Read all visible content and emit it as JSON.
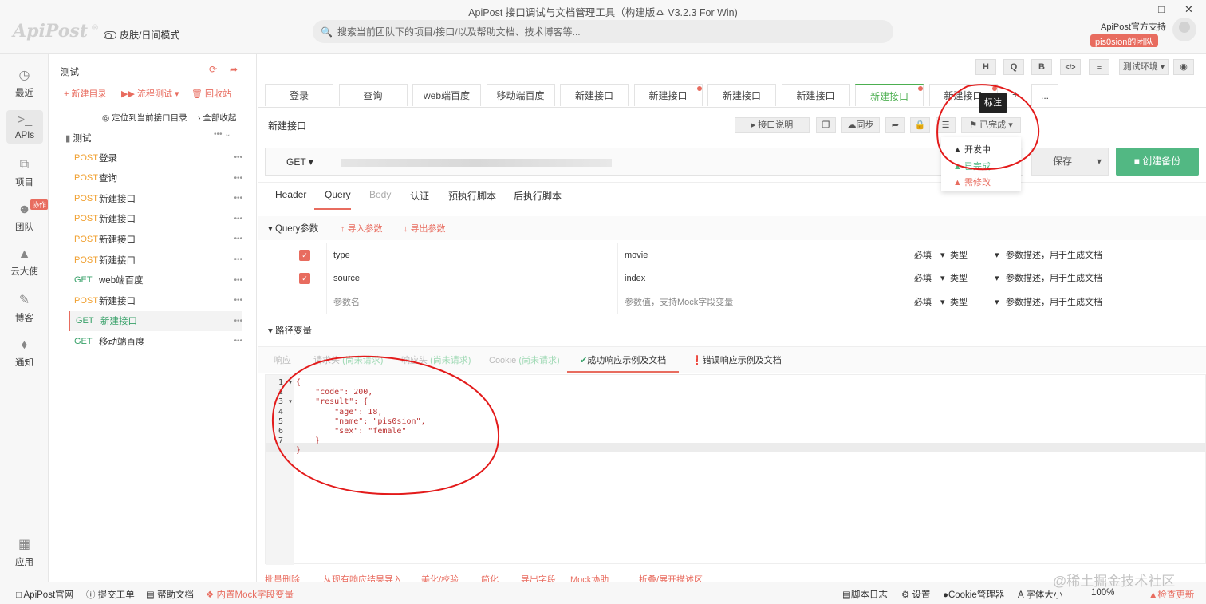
{
  "window": {
    "title": "ApiPost 接口调试与文档管理工具（构建版本 V3.2.3 For Win)",
    "logo": "ApiPost",
    "logo_mark": "®"
  },
  "header": {
    "skin_toggle": "皮肤/日间模式",
    "search_placeholder": "搜索当前团队下的项目/接口/以及帮助文档、技术博客等...",
    "support": "ApiPost官方支持",
    "team": "pis0sion的团队"
  },
  "leftnav": {
    "items": [
      {
        "label": "最近",
        "icon": "clock-icon"
      },
      {
        "label": "APIs",
        "icon": "terminal-icon"
      },
      {
        "label": "项目",
        "icon": "project-icon"
      },
      {
        "label": "团队",
        "icon": "team-icon"
      },
      {
        "label": "云大使",
        "icon": "graduation-icon"
      },
      {
        "label": "博客",
        "icon": "edit-icon"
      },
      {
        "label": "通知",
        "icon": "bell-icon"
      },
      {
        "label": "应用",
        "icon": "apps-icon"
      }
    ],
    "collab_badge": "协作"
  },
  "tree": {
    "project": "测试",
    "new_dir": "新建目录",
    "flow_test": "流程测试",
    "recycle": "回收站",
    "locate": "定位到当前接口目录",
    "collapse": "全部收起",
    "folder": "测试",
    "items": [
      {
        "method": "POST",
        "name": "登录"
      },
      {
        "method": "POST",
        "name": "查询"
      },
      {
        "method": "POST",
        "name": "新建接口"
      },
      {
        "method": "POST",
        "name": "新建接口"
      },
      {
        "method": "POST",
        "name": "新建接口"
      },
      {
        "method": "POST",
        "name": "新建接口"
      },
      {
        "method": "GET",
        "name": "web端百度"
      },
      {
        "method": "POST",
        "name": "新建接口"
      },
      {
        "method": "GET",
        "name": "新建接口"
      },
      {
        "method": "GET",
        "name": "移动端百度"
      }
    ]
  },
  "toolbar": {
    "h": "H",
    "q": "Q",
    "b": "B",
    "code": "</>",
    "env": "测试环境"
  },
  "tabs": [
    "登录",
    "查询",
    "web端百度",
    "移动端百度",
    "新建接口",
    "新建接口",
    "新建接口",
    "新建接口",
    "新建接口",
    "新建接口"
  ],
  "tab_more": "...",
  "tab_add": "+",
  "request": {
    "name": "新建接口",
    "doc_btn": "接口说明",
    "sync_btn": "同步",
    "status": "已完成",
    "method": "GET",
    "save": "保存",
    "backup": "创建备份"
  },
  "tooltip": "标注",
  "status_menu": [
    "开发中",
    "已完成",
    "需修改"
  ],
  "subtabs": [
    "Header",
    "Query",
    "Body",
    "认证",
    "预执行脚本",
    "后执行脚本"
  ],
  "query": {
    "title": "Query参数",
    "import": "导入参数",
    "export": "导出参数",
    "rows": [
      {
        "key": "type",
        "value": "movie",
        "req": "必填",
        "type": "类型",
        "desc": "参数描述，用于生成文档",
        "checked": true
      },
      {
        "key": "source",
        "value": "index",
        "req": "必填",
        "type": "类型",
        "desc": "参数描述，用于生成文档",
        "checked": true
      },
      {
        "key": "参数名",
        "value": "参数值，支持Mock字段变量",
        "req": "必填",
        "type": "类型",
        "desc": "参数描述，用于生成文档",
        "checked": false
      }
    ]
  },
  "path_vars": "路径变量",
  "resp_tabs": [
    "响应",
    "请求头",
    "(尚未请求)",
    "响应头",
    "(尚未请求)",
    "Cookie",
    "(尚未请求)",
    "成功响应示例及文档",
    "错误响应示例及文档"
  ],
  "code_lines": [
    "{",
    "    \"code\": 200,",
    "    \"result\": {",
    "        \"age\": 18,",
    "        \"name\": \"pis0sion\",",
    "        \"sex\": \"female\"",
    "    }",
    "}"
  ],
  "editor_tools": [
    "批量删除",
    "从现有响应结果导入",
    "美化/校验",
    "简化",
    "导出字段",
    "Mock协助",
    "折叠/展开描述区"
  ],
  "statusbar": {
    "official": "ApiPost官网",
    "ticket": "提交工单",
    "help": "帮助文档",
    "mock": "内置Mock字段变量",
    "log": "脚本日志",
    "settings": "设置",
    "cookie": "Cookie管理器",
    "font": "字体大小",
    "zoom": "100%",
    "update": "检查更新"
  },
  "watermark": "@稀土掘金技术社区",
  "colors": {
    "accent": "#e86c5f",
    "get": "#38a169",
    "post": "#f0a030",
    "green": "#52b883",
    "annotation": "#e31b1b"
  }
}
